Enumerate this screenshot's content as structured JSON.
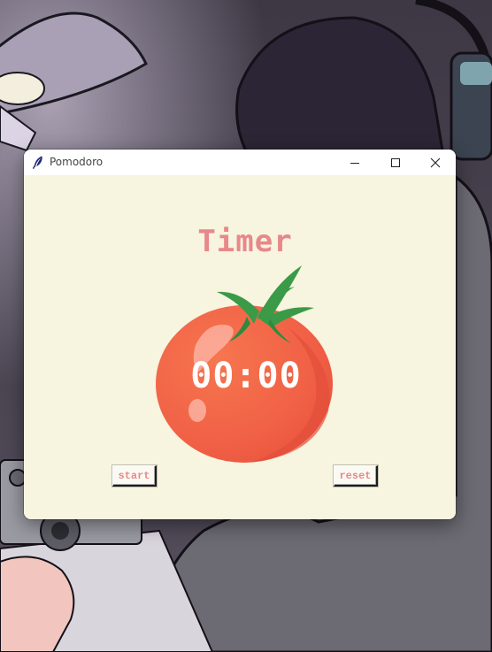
{
  "window": {
    "title": "Pomodoro",
    "app_icon": "feather-icon",
    "controls": [
      "minimize-icon",
      "maximize-icon",
      "close-icon"
    ]
  },
  "app": {
    "heading": "Timer",
    "timer": "00:00",
    "start_label": "start",
    "reset_label": "reset",
    "image": "tomato"
  },
  "colors": {
    "background": "#f7f4df",
    "accent_text": "#e7888b",
    "tomato": "#f06548",
    "leaf": "#3a9a47"
  }
}
